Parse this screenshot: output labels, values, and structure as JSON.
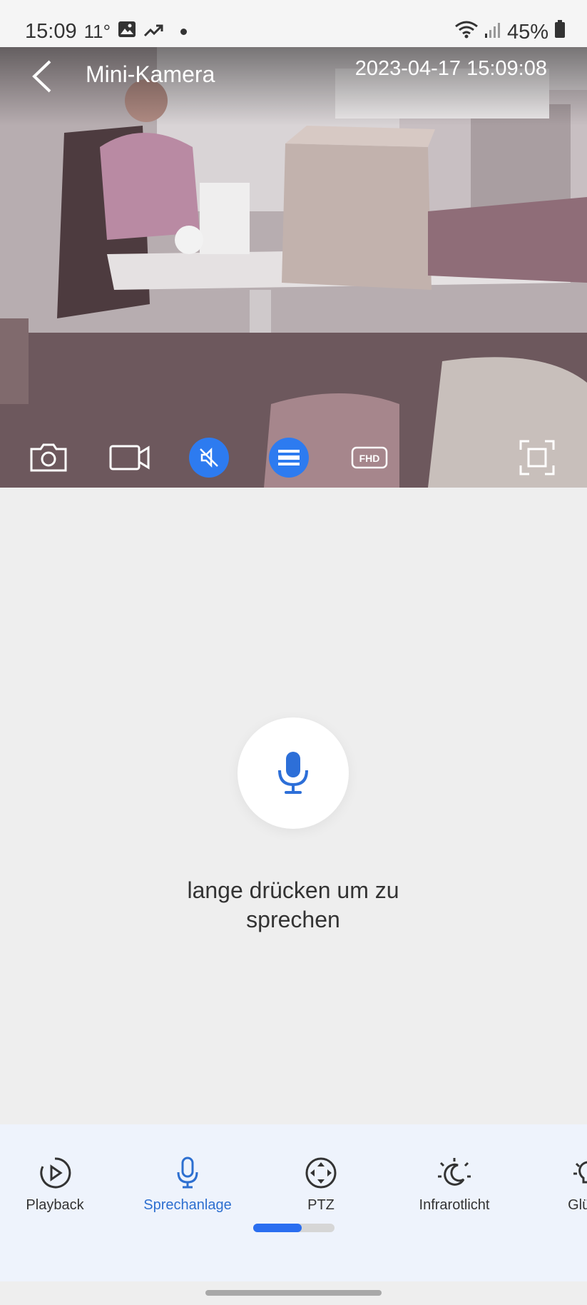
{
  "status_bar": {
    "time": "15:09",
    "temperature": "11°",
    "battery": "45%"
  },
  "camera": {
    "title": "Mini-Kamera",
    "timestamp": "2023-04-17 15:09:08",
    "quality_label": "FHD",
    "accent_color": "#2d7bf0"
  },
  "talk": {
    "hint": "lange drücken um zu sprechen"
  },
  "tabs": [
    {
      "label": "Playback",
      "icon": "playback-icon",
      "active": false
    },
    {
      "label": "Sprechanlage",
      "icon": "microphone-icon",
      "active": true
    },
    {
      "label": "PTZ",
      "icon": "ptz-icon",
      "active": false
    },
    {
      "label": "Infrarotlicht",
      "icon": "infrared-icon",
      "active": false
    },
    {
      "label": "Glühla",
      "icon": "bulb-icon",
      "active": false
    }
  ],
  "pager": {
    "position": 0.6
  }
}
